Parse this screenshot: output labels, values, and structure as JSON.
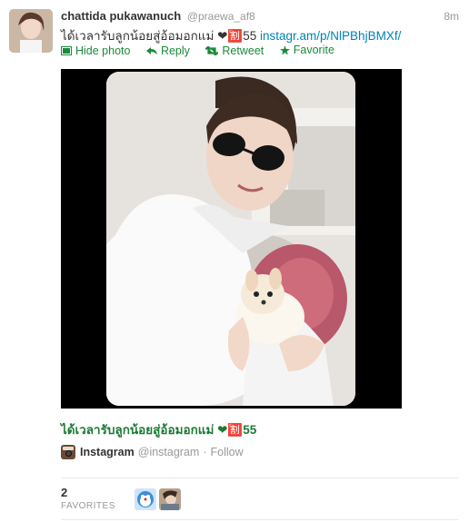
{
  "tweet": {
    "display_name": "chattida pukawanuch",
    "handle": "@praewa_af8",
    "timestamp": "8m",
    "text": "ได้เวลารับลูกน้อยสู่อ้อมอกแม่ ❤",
    "emoji_box": "🈹",
    "text_suffix": "55 ",
    "link": "instagr.am/p/NlPBhjBMXf/",
    "actions": [
      {
        "label": "Hide photo",
        "icon": "photo-icon"
      },
      {
        "label": "Reply",
        "icon": "reply-icon"
      },
      {
        "label": "Retweet",
        "icon": "retweet-icon"
      },
      {
        "label": "Favorite",
        "icon": "star-icon"
      }
    ],
    "accent_color": "#1a8a3a"
  },
  "media": {
    "caption": "ได้เวลารับลูกน้อยสู่อ้อมอกแม่ ❤",
    "caption_emoji": "🈹",
    "caption_suffix": "55",
    "source_name": "Instagram",
    "source_handle": "@instagram",
    "separator": "·",
    "follow_label": "Follow"
  },
  "stats": {
    "favorites_count": "2",
    "favorites_label": "FAVORITES"
  }
}
